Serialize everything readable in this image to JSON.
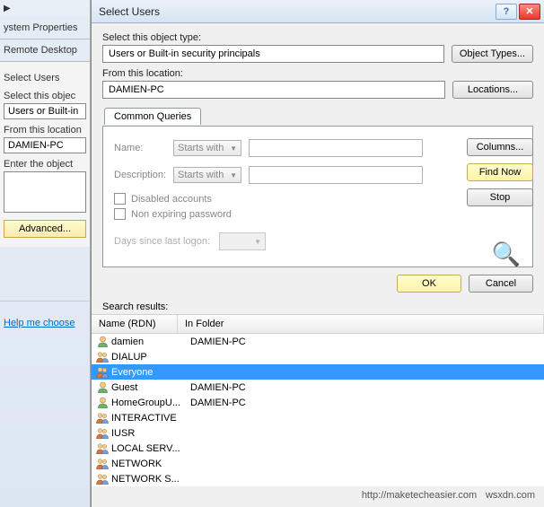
{
  "bg": {
    "triangle": "▶",
    "tab1": "ystem Properties",
    "tab2": "Remote Desktop",
    "panel_title": "Select Users",
    "obj_label": "Select this objec",
    "obj_value": "Users or Built-in",
    "loc_label": "From this location",
    "loc_value": "DAMIEN-PC",
    "enter_label": "Enter the object",
    "advanced": "Advanced...",
    "help": "Help me choose"
  },
  "dialog": {
    "title": "Select Users",
    "object_type_label": "Select this object type:",
    "object_type_value": "Users or Built-in security principals",
    "object_types_btn": "Object Types...",
    "location_label": "From this location:",
    "location_value": "DAMIEN-PC",
    "locations_btn": "Locations...",
    "tab": "Common Queries",
    "name_label": "Name:",
    "desc_label": "Description:",
    "starts_with": "Starts with",
    "disabled": "Disabled accounts",
    "non_expiring": "Non expiring password",
    "days_label": "Days since last logon:",
    "columns_btn": "Columns...",
    "find_btn": "Find Now",
    "stop_btn": "Stop",
    "ok_btn": "OK",
    "cancel_btn": "Cancel",
    "results_label": "Search results:",
    "col_name": "Name (RDN)",
    "col_folder": "In Folder"
  },
  "results": [
    {
      "icon": "user",
      "name": "damien",
      "folder": "DAMIEN-PC",
      "selected": false
    },
    {
      "icon": "group",
      "name": "DIALUP",
      "folder": "",
      "selected": false
    },
    {
      "icon": "group",
      "name": "Everyone",
      "folder": "",
      "selected": true
    },
    {
      "icon": "user",
      "name": "Guest",
      "folder": "DAMIEN-PC",
      "selected": false
    },
    {
      "icon": "user",
      "name": "HomeGroupU...",
      "folder": "DAMIEN-PC",
      "selected": false
    },
    {
      "icon": "group",
      "name": "INTERACTIVE",
      "folder": "",
      "selected": false
    },
    {
      "icon": "group",
      "name": "IUSR",
      "folder": "",
      "selected": false
    },
    {
      "icon": "group",
      "name": "LOCAL SERV...",
      "folder": "",
      "selected": false
    },
    {
      "icon": "group",
      "name": "NETWORK",
      "folder": "",
      "selected": false
    },
    {
      "icon": "group",
      "name": "NETWORK S...",
      "folder": "",
      "selected": false
    }
  ],
  "watermark1": "http://maketecheasier.com",
  "watermark2": "wsxdn.com"
}
